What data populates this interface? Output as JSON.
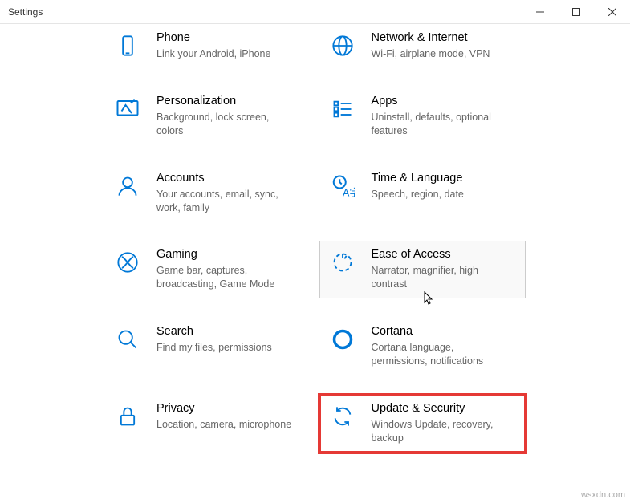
{
  "window": {
    "title": "Settings"
  },
  "tiles": {
    "phone": {
      "title": "Phone",
      "sub": "Link your Android, iPhone"
    },
    "network": {
      "title": "Network & Internet",
      "sub": "Wi-Fi, airplane mode, VPN"
    },
    "personalization": {
      "title": "Personalization",
      "sub": "Background, lock screen, colors"
    },
    "apps": {
      "title": "Apps",
      "sub": "Uninstall, defaults, optional features"
    },
    "accounts": {
      "title": "Accounts",
      "sub": "Your accounts, email, sync, work, family"
    },
    "time": {
      "title": "Time & Language",
      "sub": "Speech, region, date"
    },
    "gaming": {
      "title": "Gaming",
      "sub": "Game bar, captures, broadcasting, Game Mode"
    },
    "ease": {
      "title": "Ease of Access",
      "sub": "Narrator, magnifier, high contrast"
    },
    "search": {
      "title": "Search",
      "sub": "Find my files, permissions"
    },
    "cortana": {
      "title": "Cortana",
      "sub": "Cortana language, permissions, notifications"
    },
    "privacy": {
      "title": "Privacy",
      "sub": "Location, camera, microphone"
    },
    "update": {
      "title": "Update & Security",
      "sub": "Windows Update, recovery, backup"
    }
  },
  "watermark": "wsxdn.com"
}
